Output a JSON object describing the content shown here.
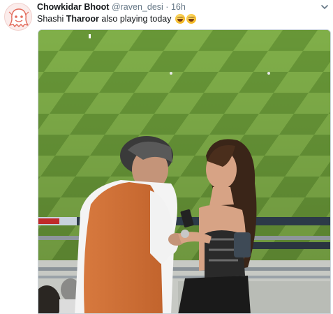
{
  "tweet": {
    "author_name": "Chowkidar Bhoot",
    "handle": "@raven_desi",
    "separator": "·",
    "time": "16h",
    "text_before": "Shashi ",
    "text_bold": "Tharoor",
    "text_after": " also playing today",
    "emojis": [
      "grinning-squinting-face-icon",
      "face-with-tears-of-joy-icon"
    ]
  },
  "media": {
    "description_icon": "photo-stadium"
  },
  "colors": {
    "name": "#14171a",
    "secondary": "#657786",
    "grass_light": "#7fb045",
    "grass_dark": "#5a8a2b"
  }
}
